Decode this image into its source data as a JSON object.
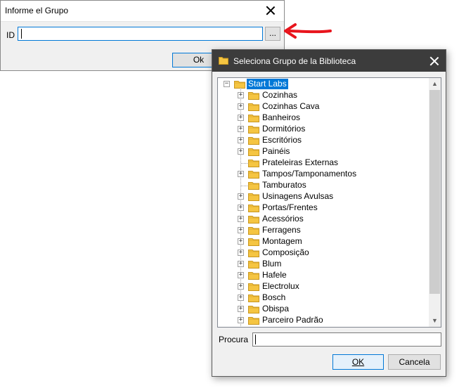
{
  "dialog_id": {
    "title": "Informe el  Grupo",
    "id_label": "ID",
    "id_value": "",
    "browse_label": "...",
    "ok_label": "Ok"
  },
  "dialog_group": {
    "title": "Seleciona Grupo de la Biblioteca",
    "tree": {
      "root": "Start Labs",
      "items": [
        {
          "label": "Cozinhas",
          "expandable": true
        },
        {
          "label": "Cozinhas Cava",
          "expandable": true
        },
        {
          "label": "Banheiros",
          "expandable": true
        },
        {
          "label": "Dormitórios",
          "expandable": true
        },
        {
          "label": "Escritórios",
          "expandable": true
        },
        {
          "label": "Painéis",
          "expandable": true
        },
        {
          "label": "Prateleiras Externas",
          "expandable": false
        },
        {
          "label": "Tampos/Tamponamentos",
          "expandable": true
        },
        {
          "label": "Tamburatos",
          "expandable": false
        },
        {
          "label": "Usinagens Avulsas",
          "expandable": true
        },
        {
          "label": "Portas/Frentes",
          "expandable": true
        },
        {
          "label": "Acessórios",
          "expandable": true
        },
        {
          "label": "Ferragens",
          "expandable": true
        },
        {
          "label": "Montagem",
          "expandable": true
        },
        {
          "label": "Composição",
          "expandable": true
        },
        {
          "label": "Blum",
          "expandable": true
        },
        {
          "label": "Hafele",
          "expandable": true
        },
        {
          "label": "Electrolux",
          "expandable": true
        },
        {
          "label": "Bosch",
          "expandable": true
        },
        {
          "label": "Obispa",
          "expandable": true
        },
        {
          "label": "Parceiro Padrão",
          "expandable": true
        }
      ]
    },
    "search_label": "Procura",
    "search_value": "",
    "ok_label": "OK",
    "cancel_label": "Cancela"
  },
  "colors": {
    "accent": "#0078d7",
    "arrow": "#e8141c",
    "folder": "#f5c542"
  }
}
